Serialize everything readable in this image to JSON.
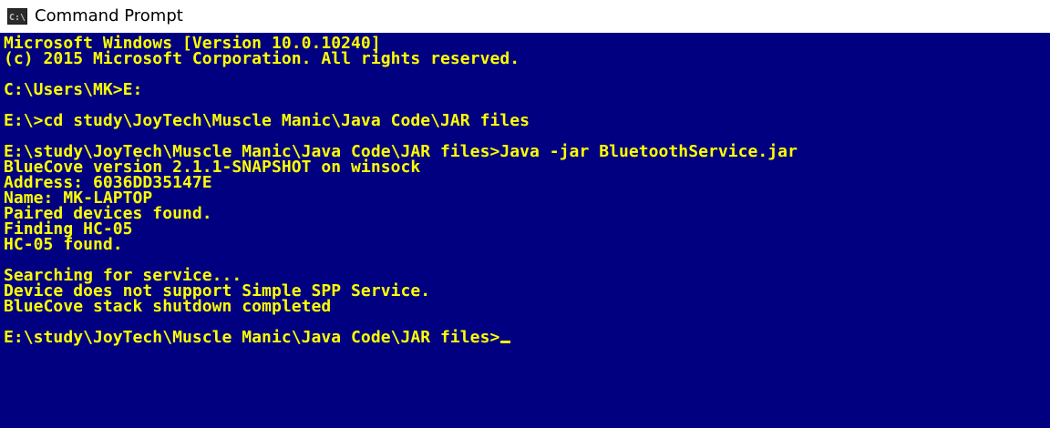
{
  "window": {
    "title": "Command Prompt",
    "icon": "console-icon",
    "colors": {
      "background": "#000080",
      "foreground": "#ffff00"
    }
  },
  "console": {
    "lines": [
      "Microsoft Windows [Version 10.0.10240]",
      "(c) 2015 Microsoft Corporation. All rights reserved.",
      "",
      "C:\\Users\\MK>E:",
      "",
      "E:\\>cd study\\JoyTech\\Muscle Manic\\Java Code\\JAR files",
      "",
      "E:\\study\\JoyTech\\Muscle Manic\\Java Code\\JAR files>Java -jar BluetoothService.jar",
      "BlueCove version 2.1.1-SNAPSHOT on winsock",
      "Address: 6036DD35147E",
      "Name: MK-LAPTOP",
      "Paired devices found.",
      "Finding HC-05",
      "HC-05 found.",
      "",
      "Searching for service...",
      "Device does not support Simple SPP Service.",
      "BlueCove stack shutdown completed",
      "",
      "E:\\study\\JoyTech\\Muscle Manic\\Java Code\\JAR files>"
    ]
  }
}
